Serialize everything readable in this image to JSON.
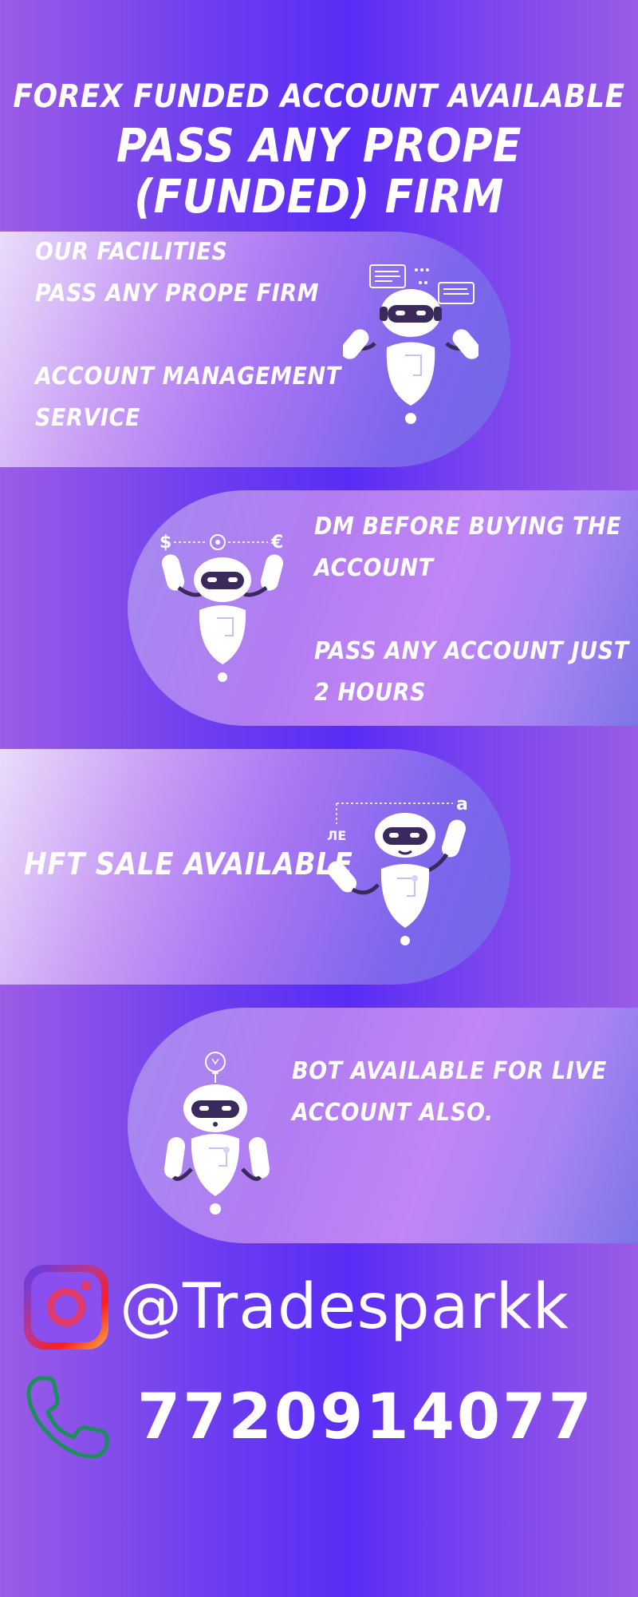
{
  "header": {
    "line1": "FOREX FUNDED ACCOUNT AVAILABLE",
    "line2": "PASS ANY PROPE (FUNDED) FIRM"
  },
  "panels": [
    {
      "text": "OUR FACILITIES\nPASS ANY PROPE FIRM\n\nACCOUNT MANAGEMENT\nSERVICE"
    },
    {
      "text": "DM BEFORE BUYING THE\nACCOUNT\n\nPASS ANY ACCOUNT JUST\n2 HOURS"
    },
    {
      "text": "HFT SALE AVAILABLE"
    },
    {
      "text": "BOT AVAILABLE FOR LIVE\nACCOUNT ALSO."
    }
  ],
  "bot_labels": {
    "dollar": "$",
    "euro": "€",
    "letter_a": "a",
    "script": "ЛE"
  },
  "contact": {
    "instagram_handle": "@Tradesparkk",
    "phone_number": "7720914077"
  },
  "icons": [
    "instagram-icon",
    "phone-icon",
    "robot-icon",
    "lightbulb-icon",
    "gear-icon",
    "document-icon"
  ],
  "colors": {
    "background": "#5a2cf5",
    "text": "#ffffff",
    "phone_icon": "#1a8f5a"
  }
}
